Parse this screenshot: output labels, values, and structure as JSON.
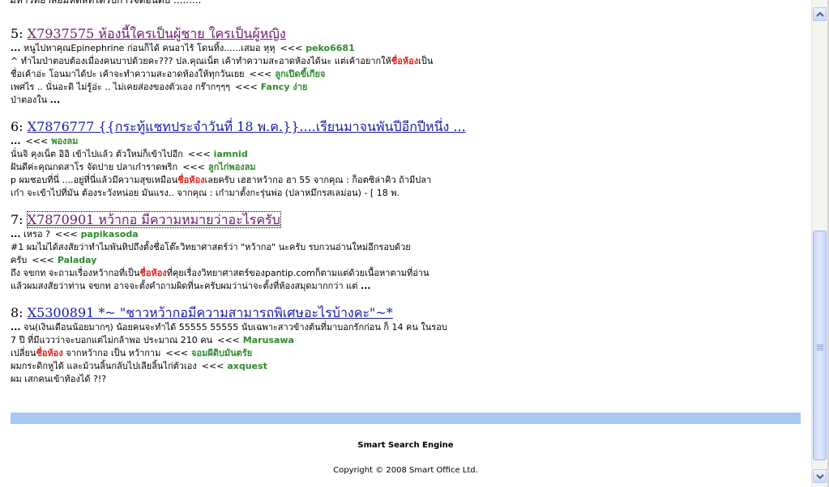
{
  "top_clip": "มหาวิทยาลัยมหิดลที่ได้รับการจัดอันดับ .........",
  "results": [
    {
      "num": "5:",
      "title": "X7937575 ห้องนี้ใครเป็นผู้ชาย ใครเป็นผู้หญิง",
      "lines": [
        {
          "pre": "...",
          "text": " หนูไปหาคุณEpinephrine ก่อนก็ได้ คนอาไร้ โดนทิ้ง......เสมอ หุหุ",
          "arrow": "<<<",
          "user": "peko6681"
        },
        {
          "text": "^ ทำไมป่าตอบต้องเมื่องคนบาปด้วยคะ??? ปล.คุณเน็ต เค้าทำความสะอาดห้องได้นะ แต่เค้าอยากให้",
          "hl": "ชื่อห้อง",
          "post": "เป็น"
        },
        {
          "text": "ชื่อเค้าอ่ะ โอนมาได้ปะ เค้าจะทำความสะอาดห้องให้ทุกวันเยย",
          "arrow": "<<<",
          "user": "ลูกเปิดขี้เกียจ"
        },
        {
          "text": "เพศไร .. นั่นอะดิ ไม่รู้อ่ะ .. ไม่เคยส่องของตัวเอง กร๊ากๆๆๆ",
          "arrow": "<<<",
          "user": "Fancy ง่าย"
        },
        {
          "text": "ป่าตองใน ",
          "post_dots": "..."
        }
      ]
    },
    {
      "num": "6:",
      "title": "X7876777 {{กระทู้แชทประจำวันที่ 18 พ.ค.}}....เรียนมาจนพันปีอีกปีหนึ่ง ...",
      "lines": [
        {
          "pre": "...",
          "text": "",
          "arrow": "<<<",
          "user": "พองลม"
        },
        {
          "text": "นั่นจิ คุงเน็ต อิอิ เข้าไปแล้ว ตัวใหม่ก็เข้าไปอีก",
          "arrow": "<<<",
          "user": "iamnid"
        },
        {
          "text": "ฝันดีค่ะคุณกดสาโร จัดปาย ปลาเก๋าราดพริก",
          "arrow": "<<<",
          "user": "ลูกไก่พองลม"
        },
        {
          "text": "p ผมชอบที่นี่ ....อยู่ที่นี่แล้วมีความสุขเหมือน",
          "hl": "ชื่อห้อง",
          "post": "เลยครับ เฮฮาหว้ากอ ฮา 55 จากคุณ : ก็อตซิล่าคิว ถ้ามีปลา"
        },
        {
          "text": "เก๋า จะเข้าไปที่มัน ต้องระวังหน่อย มันแรง.. จากคุณ : เก๋ามาตั้งกะรุ่นพ่อ (ปลาหมึกรสเลม่อน) - [ 18 พ."
        }
      ]
    },
    {
      "num": "7:",
      "title": "X7870901 หว้ากอ มีความหมายว่าอะไรครับ",
      "lines": [
        {
          "pre": "...",
          "text": " เหรอ ?",
          "arrow": "<<<",
          "user": "papikasoda"
        },
        {
          "text": "#1 ผมไม่ได้สงสัยว่าทำไมพันทิปถึงตั้งชื่อโต๊ะวิทยาศาสตร์ว่า \"หว้ากอ\" นะครับ รบกวนอ่านใหม่อีกรอบด้วย"
        },
        {
          "text": "ครับ",
          "arrow": "<<<",
          "user": "Paladay"
        },
        {
          "text": "ถึง จขกท จะถามเรื่องหว้ากอที่เป็น",
          "hl": "ชื่อห้อง",
          "post": "ที่คุยเรื่องวิทยาศาสตร์ของpantip.comก็ตามแต่ด้วยเนื้อหาตามที่อ่าน"
        },
        {
          "text": "แล้วผมสงสัยว่าท่าน จขกท อาจจะตั้งคำถามผิดที่นะครับผมว่าน่าจะตั้งที่ห้องสมุดมากกว่า แต่ ",
          "post_dots": "..."
        }
      ]
    },
    {
      "num": "8:",
      "title": "X5300891 *~ \"ชาวหว้ากอมีความสามารถพิเศษอะไรบ้างคะ\"~*",
      "lines": [
        {
          "pre": "...",
          "text": " จน(เงินเดือนน้อยมากๆ) น้อยคนจะทำได้ 55555 55555 นับเฉพาะสาวข้างต้นที่มาบอกรักก่อน ก็ 14 คน ในรอบ"
        },
        {
          "text": "7 ปี ที่มีแววว่าจะบอกแต่ไม่กล้าพอ ประมาณ 210 คน",
          "arrow": "<<<",
          "user": "Marusawa"
        },
        {
          "text": "เปลี่ยน",
          "hl": "ชื่อห้อง",
          "post": " จากหว้ากอ เป็น หว้ากาม",
          "arrow": "<<<",
          "user": "จอมผีดิบมันตรัย"
        },
        {
          "text": "ผมกระดิกหูได้ และม้วนลิ้นกลับไปเลียลิ้นไก่ตัวเอง",
          "arrow": "<<<",
          "user": "axquest"
        },
        {
          "text": "ผม เสกคนเข้าท้องได้ ?!?"
        }
      ]
    }
  ],
  "footer": {
    "engine": "Smart Search Engine",
    "copyright": "Copyright © 2008 Smart Office Ltd."
  },
  "colors": {
    "link": "#1a1aa6",
    "visited": "#6a1b6e",
    "username": "#2d8a2d",
    "highlight": "#e0201c",
    "bar": "#a7c8f2"
  }
}
